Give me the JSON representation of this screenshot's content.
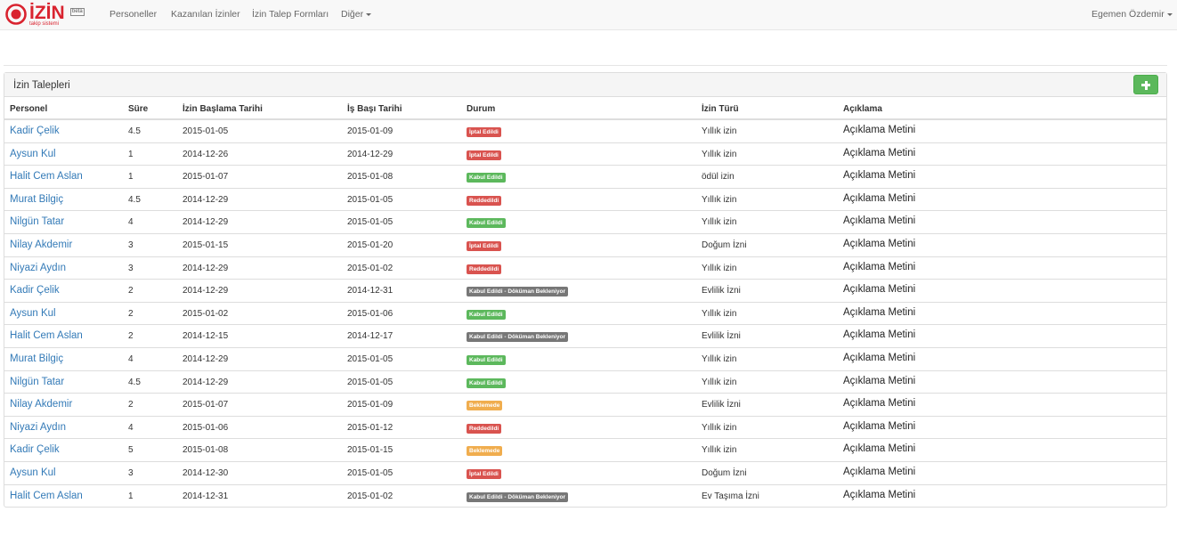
{
  "brand": {
    "name": "İZİN",
    "tag": "beta",
    "subtitle": "takip sistemi"
  },
  "nav": {
    "items": [
      "Personeller",
      "Kazanılan İzinler",
      "İzin Talep Formları",
      "Diğer"
    ],
    "user": "Egemen Özdemir"
  },
  "panel": {
    "title": "İzin Talepleri",
    "add_label": "+"
  },
  "table": {
    "headers": [
      "Personel",
      "Süre",
      "İzin Başlama Tarihi",
      "İş Başı Tarihi",
      "Durum",
      "İzin Türü",
      "Açıklama"
    ],
    "rows": [
      {
        "personel": "Kadir Çelik",
        "sure": "4.5",
        "baslama": "2015-01-05",
        "isbasi": "2015-01-09",
        "durum": "İptal Edildi",
        "renk": "#d9534f",
        "tur": "Yıllık izin",
        "aciklama": "Açıklama Metini"
      },
      {
        "personel": "Aysun Kul",
        "sure": "1",
        "baslama": "2014-12-26",
        "isbasi": "2014-12-29",
        "durum": "İptal Edildi",
        "renk": "#d9534f",
        "tur": "Yıllık izin",
        "aciklama": "Açıklama Metini"
      },
      {
        "personel": "Halit Cem Aslan",
        "sure": "1",
        "baslama": "2015-01-07",
        "isbasi": "2015-01-08",
        "durum": "Kabul Edildi",
        "renk": "#5cb85c",
        "tur": "ödül izin",
        "aciklama": "Açıklama Metini"
      },
      {
        "personel": "Murat Bilgiç",
        "sure": "4.5",
        "baslama": "2014-12-29",
        "isbasi": "2015-01-05",
        "durum": "Reddedildi",
        "renk": "#d9534f",
        "tur": "Yıllık izin",
        "aciklama": "Açıklama Metini"
      },
      {
        "personel": "Nilgün Tatar",
        "sure": "4",
        "baslama": "2014-12-29",
        "isbasi": "2015-01-05",
        "durum": "Kabul Edildi",
        "renk": "#5cb85c",
        "tur": "Yıllık izin",
        "aciklama": "Açıklama Metini"
      },
      {
        "personel": "Nilay Akdemir",
        "sure": "3",
        "baslama": "2015-01-15",
        "isbasi": "2015-01-20",
        "durum": "İptal Edildi",
        "renk": "#d9534f",
        "tur": "Doğum İzni",
        "aciklama": "Açıklama Metini"
      },
      {
        "personel": "Niyazi Aydın",
        "sure": "3",
        "baslama": "2014-12-29",
        "isbasi": "2015-01-02",
        "durum": "Reddedildi",
        "renk": "#d9534f",
        "tur": "Yıllık izin",
        "aciklama": "Açıklama Metini"
      },
      {
        "personel": "Kadir Çelik",
        "sure": "2",
        "baslama": "2014-12-29",
        "isbasi": "2014-12-31",
        "durum": "Kabul Edildi - Döküman Bekleniyor",
        "renk": "#777777",
        "tur": "Evlilik İzni",
        "aciklama": "Açıklama Metini"
      },
      {
        "personel": "Aysun Kul",
        "sure": "2",
        "baslama": "2015-01-02",
        "isbasi": "2015-01-06",
        "durum": "Kabul Edildi",
        "renk": "#5cb85c",
        "tur": "Yıllık izin",
        "aciklama": "Açıklama Metini"
      },
      {
        "personel": "Halit Cem Aslan",
        "sure": "2",
        "baslama": "2014-12-15",
        "isbasi": "2014-12-17",
        "durum": "Kabul Edildi - Döküman Bekleniyor",
        "renk": "#777777",
        "tur": "Evlilik İzni",
        "aciklama": "Açıklama Metini"
      },
      {
        "personel": "Murat Bilgiç",
        "sure": "4",
        "baslama": "2014-12-29",
        "isbasi": "2015-01-05",
        "durum": "Kabul Edildi",
        "renk": "#5cb85c",
        "tur": "Yıllık izin",
        "aciklama": "Açıklama Metini"
      },
      {
        "personel": "Nilgün Tatar",
        "sure": "4.5",
        "baslama": "2014-12-29",
        "isbasi": "2015-01-05",
        "durum": "Kabul Edildi",
        "renk": "#5cb85c",
        "tur": "Yıllık izin",
        "aciklama": "Açıklama Metini"
      },
      {
        "personel": "Nilay Akdemir",
        "sure": "2",
        "baslama": "2015-01-07",
        "isbasi": "2015-01-09",
        "durum": "Beklemede",
        "renk": "#f0ad4e",
        "tur": "Evlilik İzni",
        "aciklama": "Açıklama Metini"
      },
      {
        "personel": "Niyazi Aydın",
        "sure": "4",
        "baslama": "2015-01-06",
        "isbasi": "2015-01-12",
        "durum": "Reddedildi",
        "renk": "#d9534f",
        "tur": "Yıllık izin",
        "aciklama": "Açıklama Metini"
      },
      {
        "personel": "Kadir Çelik",
        "sure": "5",
        "baslama": "2015-01-08",
        "isbasi": "2015-01-15",
        "durum": "Beklemede",
        "renk": "#f0ad4e",
        "tur": "Yıllık izin",
        "aciklama": "Açıklama Metini"
      },
      {
        "personel": "Aysun Kul",
        "sure": "3",
        "baslama": "2014-12-30",
        "isbasi": "2015-01-05",
        "durum": "İptal Edildi",
        "renk": "#d9534f",
        "tur": "Doğum İzni",
        "aciklama": "Açıklama Metini"
      },
      {
        "personel": "Halit Cem Aslan",
        "sure": "1",
        "baslama": "2014-12-31",
        "isbasi": "2015-01-02",
        "durum": "Kabul Edildi - Döküman Bekleniyor",
        "renk": "#777777",
        "tur": "Ev Taşıma İzni",
        "aciklama": "Açıklama Metini"
      }
    ]
  }
}
